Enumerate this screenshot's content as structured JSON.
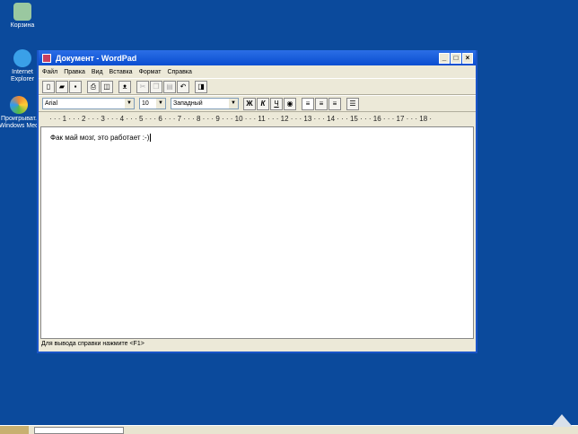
{
  "desktop": {
    "icons": [
      {
        "label": "Корзина",
        "icon": "recycle-bin-icon"
      },
      {
        "label": "Internet Explorer",
        "icon": "ie-icon"
      },
      {
        "label": "Проигрыват. Windows Med",
        "icon": "media-player-icon"
      }
    ]
  },
  "window": {
    "title": "Документ - WordPad",
    "minimize": "_",
    "maximize": "□",
    "close": "×"
  },
  "menu": [
    "Файл",
    "Правка",
    "Вид",
    "Вставка",
    "Формат",
    "Справка"
  ],
  "format_bar": {
    "font": "Arial",
    "size": "10",
    "script": "Западный",
    "bold": "Ж",
    "italic": "К",
    "underline": "Ч"
  },
  "ruler": "· · · 1 · · · 2 · · · 3 · · · 4 · · · 5 · · · 6 · · · 7 · · · 8 · · · 9 · · · 10 · · · 11 · · · 12 · · · 13 · · · 14 · · · 15 · · · 16 · · · 17 · · · 18 ·",
  "document": {
    "text": "Фак май мозг, это работает :-)"
  },
  "status": {
    "text": "Для вывода справки нажмите <F1>"
  }
}
